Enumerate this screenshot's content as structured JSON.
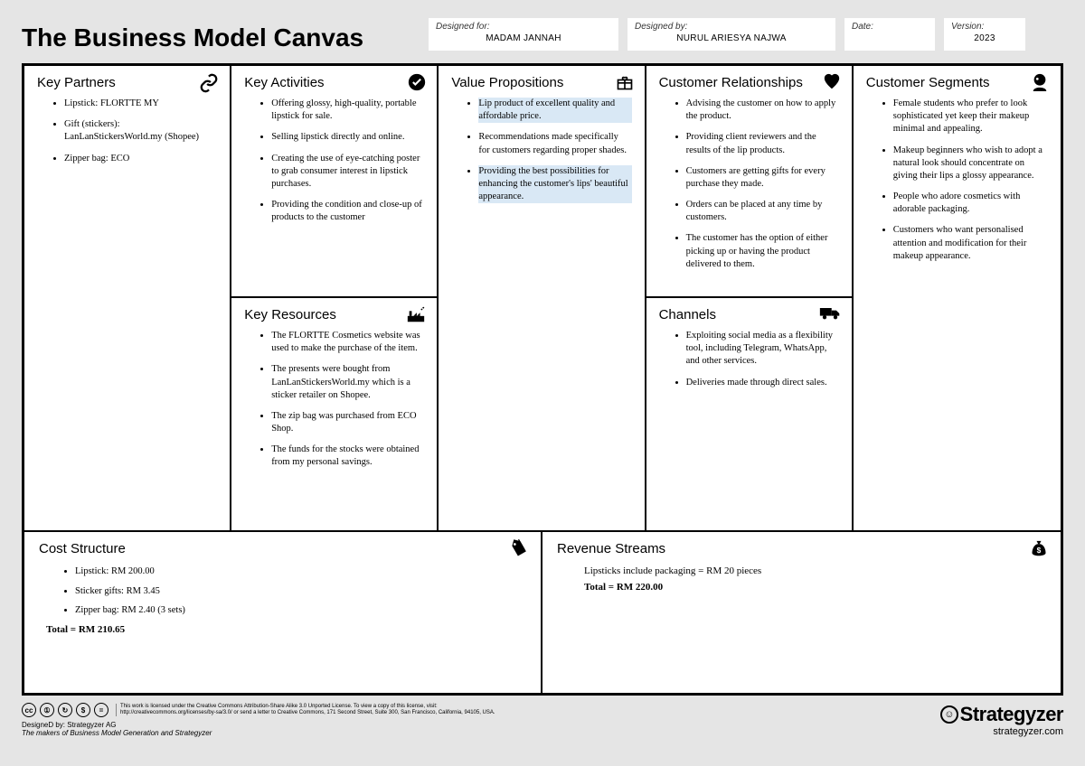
{
  "title": "The Business Model Canvas",
  "meta": {
    "designed_for_label": "Designed for:",
    "designed_for_value": "MADAM JANNAH",
    "designed_by_label": "Designed by:",
    "designed_by_value": "NURUL ARIESYA NAJWA",
    "date_label": "Date:",
    "date_value": "",
    "version_label": "Version:",
    "version_value": "2023"
  },
  "sections": {
    "key_partners": {
      "title": "Key Partners",
      "items": [
        "Lipstick: FLORTTE MY",
        "Gift (stickers): LanLanStickersWorld.my (Shopee)",
        "Zipper bag: ECO"
      ]
    },
    "key_activities": {
      "title": "Key Activities",
      "items": [
        "Offering glossy, high-quality, portable lipstick for sale.",
        "Selling lipstick directly and online.",
        "Creating the use of eye-catching poster to grab consumer interest in lipstick purchases.",
        "Providing the condition and close-up of products to the customer"
      ]
    },
    "key_resources": {
      "title": "Key Resources",
      "items": [
        "The FLORTTE Cosmetics website was used to make the purchase of the item.",
        "The presents were bought from LanLanStickersWorld.my which is a sticker retailer on Shopee.",
        "The zip bag was purchased from ECO Shop.",
        "The funds for the stocks were obtained from my personal savings."
      ]
    },
    "value_propositions": {
      "title": "Value Propositions",
      "items": [
        "Lip product of excellent quality and affordable price.",
        "Recommendations made specifically for customers regarding proper shades.",
        "Providing the best possibilities for enhancing the customer's lips' beautiful appearance."
      ]
    },
    "customer_relationships": {
      "title": "Customer Relationships",
      "items": [
        "Advising the customer on how to apply the product.",
        "Providing client reviewers and the results of the lip products.",
        "Customers are getting gifts for every purchase they made.",
        "Orders can be placed at any time by customers.",
        "The customer has the option of either picking up or having the product delivered to them."
      ]
    },
    "channels": {
      "title": "Channels",
      "items": [
        "Exploiting social media as a flexibility tool, including Telegram, WhatsApp, and other services.",
        "Deliveries made through direct sales."
      ]
    },
    "customer_segments": {
      "title": "Customer Segments",
      "items": [
        "Female students who prefer to look sophisticated yet keep their makeup minimal and appealing.",
        "Makeup beginners who wish to adopt a natural look should concentrate on giving their lips a glossy appearance.",
        "People who adore cosmetics with adorable packaging.",
        "Customers who want personalised attention and modification for their makeup appearance."
      ]
    },
    "cost_structure": {
      "title": "Cost Structure",
      "items": [
        "Lipstick: RM 200.00",
        "Sticker gifts: RM 3.45",
        "Zipper bag: RM 2.40 (3 sets)"
      ],
      "total": "Total = RM 210.65"
    },
    "revenue_streams": {
      "title": "Revenue Streams",
      "line": "Lipsticks include packaging = RM 20 pieces",
      "total": "Total = RM 220.00"
    }
  },
  "footer": {
    "license": "This work is licensed under the Creative Commons Attribution-Share Alike 3.0 Unported License. To view a copy of this license, visit: http://creativecommons.org/licenses/by-sa/3.0/ or send a letter to Creative Commons, 171 Second Street, Suite 300, San Francisco, California, 94105, USA.",
    "credits_label": "DesigneD by:",
    "credits_value": "Strategyzer AG",
    "credits_sub": "The makers of Business Model Generation and Strategyzer",
    "brand": "Strategyzer",
    "brand_url": "strategyzer.com"
  }
}
